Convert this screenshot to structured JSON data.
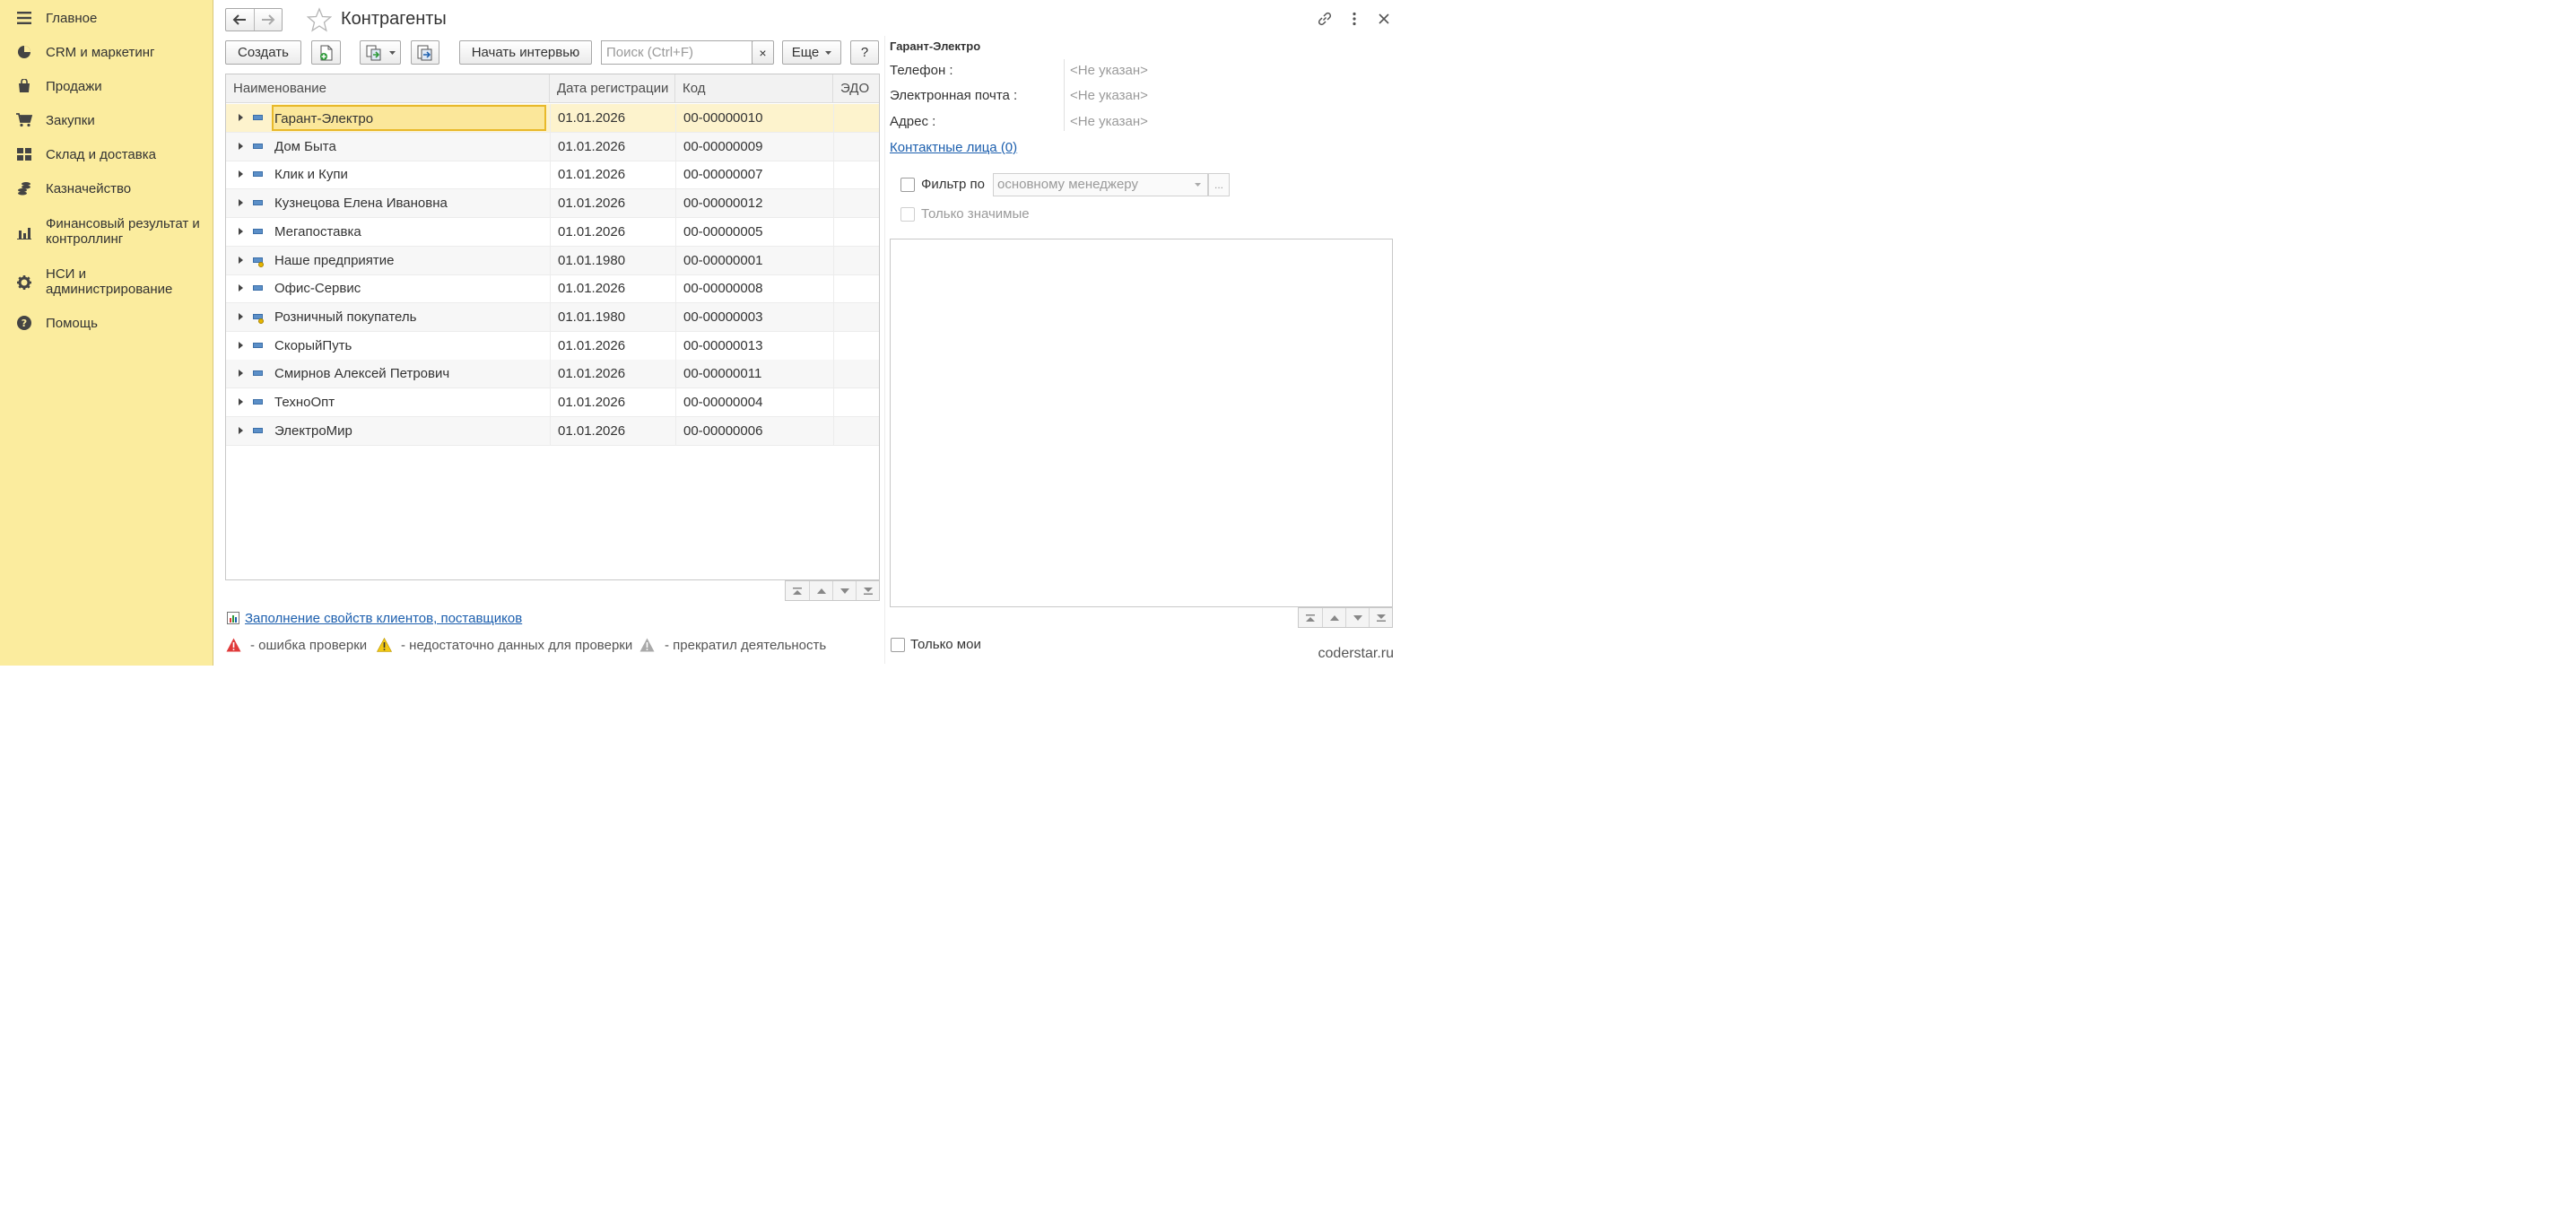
{
  "sidebar": {
    "items": [
      {
        "label": "Главное",
        "icon": "menu-icon"
      },
      {
        "label": "CRM и маркетинг",
        "icon": "pie-chart-icon"
      },
      {
        "label": "Продажи",
        "icon": "shopping-bag-icon"
      },
      {
        "label": "Закупки",
        "icon": "cart-icon"
      },
      {
        "label": "Склад и доставка",
        "icon": "warehouse-icon"
      },
      {
        "label": "Казначейство",
        "icon": "coins-icon"
      },
      {
        "label": "Финансовый результат и контроллинг",
        "icon": "bar-chart-icon"
      },
      {
        "label": "НСИ и администрирование",
        "icon": "gear-icon"
      },
      {
        "label": "Помощь",
        "icon": "help-icon"
      }
    ]
  },
  "header": {
    "title": "Контрагенты"
  },
  "toolbar": {
    "create_label": "Создать",
    "interview_label": "Начать интервью",
    "search_placeholder": "Поиск (Ctrl+F)",
    "clear_label": "×",
    "more_label": "Еще",
    "help_label": "?"
  },
  "table": {
    "columns": [
      "Наименование",
      "Дата регистрации",
      "Код",
      "ЭДО"
    ],
    "rows": [
      {
        "name": "Гарант-Электро",
        "date": "01.01.2026",
        "code": "00-00000010",
        "edo": "",
        "own": false
      },
      {
        "name": "Дом Быта",
        "date": "01.01.2026",
        "code": "00-00000009",
        "edo": "",
        "own": false
      },
      {
        "name": "Клик и Купи",
        "date": "01.01.2026",
        "code": "00-00000007",
        "edo": "",
        "own": false
      },
      {
        "name": "Кузнецова Елена Ивановна",
        "date": "01.01.2026",
        "code": "00-00000012",
        "edo": "",
        "own": false
      },
      {
        "name": "Мегапоставка",
        "date": "01.01.2026",
        "code": "00-00000005",
        "edo": "",
        "own": false
      },
      {
        "name": "Наше предприятие",
        "date": "01.01.1980",
        "code": "00-00000001",
        "edo": "",
        "own": true
      },
      {
        "name": "Офис-Сервис",
        "date": "01.01.2026",
        "code": "00-00000008",
        "edo": "",
        "own": false
      },
      {
        "name": "Розничный покупатель",
        "date": "01.01.1980",
        "code": "00-00000003",
        "edo": "",
        "own": true
      },
      {
        "name": "СкорыйПуть",
        "date": "01.01.2026",
        "code": "00-00000013",
        "edo": "",
        "own": false
      },
      {
        "name": "Смирнов Алексей Петрович",
        "date": "01.01.2026",
        "code": "00-00000011",
        "edo": "",
        "own": false
      },
      {
        "name": "ТехноОпт",
        "date": "01.01.2026",
        "code": "00-00000004",
        "edo": "",
        "own": false
      },
      {
        "name": "ЭлектроМир",
        "date": "01.01.2026",
        "code": "00-00000006",
        "edo": "",
        "own": false
      }
    ],
    "selected_index": 0
  },
  "footer": {
    "fill_link": "Заполнение свойств клиентов, поставщиков",
    "legend": [
      {
        "text": "- ошибка проверки",
        "color": "#e03a3a"
      },
      {
        "text": "- недостаточно данных для проверки",
        "color": "#f2c811"
      },
      {
        "text": "- прекратил деятельность",
        "color": "#9a9a9a"
      }
    ]
  },
  "details": {
    "title": "Гарант-Электро",
    "phone_label": "Телефон :",
    "phone_value": "<Не указан>",
    "email_label": "Электронная почта :",
    "email_value": "<Не указан>",
    "address_label": "Адрес :",
    "address_value": "<Не указан>",
    "contacts_link": "Контактные лица (0)",
    "filter_label": "Фильтр по",
    "filter_value": "основному менеджеру",
    "filter_dots": "...",
    "only_significant": "Только значимые",
    "only_mine": "Только мои"
  },
  "watermark": "coderstar.ru",
  "colors": {
    "sidebar_bg": "#fbec9e",
    "selection": "#fdf3cd",
    "link": "#1c5fae"
  }
}
